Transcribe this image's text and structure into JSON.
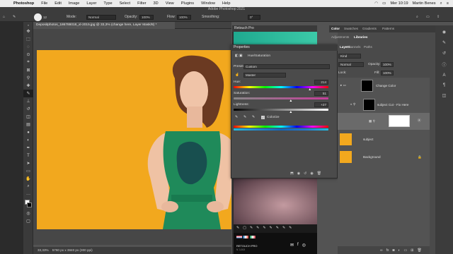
{
  "menubar": {
    "app": "Photoshop",
    "items": [
      "File",
      "Edit",
      "Image",
      "Layer",
      "Type",
      "Select",
      "Filter",
      "3D",
      "View",
      "Plugins",
      "Window",
      "Help"
    ],
    "clock": "Mer 10:19",
    "user": "Martin Benes"
  },
  "window_title": "Adobe Photoshop 2021",
  "options": {
    "mode_label": "Mode:",
    "mode_value": "Normal",
    "opacity_label": "Opacity:",
    "opacity_value": "100%",
    "flow_label": "Flow:",
    "flow_value": "100%",
    "smoothing_label": "Smoothing:",
    "angle_value": "0°",
    "brush_size": "12"
  },
  "doc": {
    "tab_title": "Depositphotos_186788018_xl-2015.jpg @ 33,3% (change here, Layer Mask/8) *",
    "zoom": "33,33%",
    "size": "5760 px x 3840 px (300 ppi)"
  },
  "retouch": {
    "title": "Retouch Pro",
    "footer_brand": "RETOUCH PRO",
    "footer_version": "V. 1.0.0"
  },
  "properties": {
    "title": "Properties",
    "adjustment": "Hue/Saturation",
    "preset_label": "Preset:",
    "preset_value": "Custom",
    "channel_value": "Master",
    "hue_label": "Hue:",
    "hue_value": "214",
    "saturation_label": "Saturation:",
    "saturation_value": "51",
    "lightness_label": "Lightness:",
    "lightness_value": "+27",
    "colorize_label": "Colorize",
    "colorize_checked": true,
    "hue_fraction": 0.8,
    "saturation_fraction": 0.6,
    "lightness_fraction": 0.6
  },
  "right_panel": {
    "tabs": [
      "Color",
      "Swatches",
      "Gradients",
      "Patterns"
    ],
    "tabs2": [
      "Adjustments",
      "Libraries"
    ],
    "layer_tabs": [
      "Layers",
      "Channels",
      "Paths"
    ],
    "kind_label": "Kind",
    "blend_value": "Normal",
    "opacity_label": "Opacity:",
    "opacity_value": "100%",
    "fill_label": "Fill:",
    "fill_value": "100%",
    "lock_label": "Lock:"
  },
  "layers": [
    {
      "name": "Change Color",
      "thumb": "#000000"
    },
    {
      "name": "subject Cut - Fix Here",
      "thumb": "#000000"
    },
    {
      "name": "",
      "thumb": "#ffffff"
    },
    {
      "name": "subject",
      "thumb": "#f2a81e"
    },
    {
      "name": "Background",
      "thumb": "#f2a81e"
    }
  ],
  "colors": {
    "accent_teal": "#1fa98f",
    "background_yellow": "#f2a81e",
    "dress_green": "#1f8a5a"
  }
}
